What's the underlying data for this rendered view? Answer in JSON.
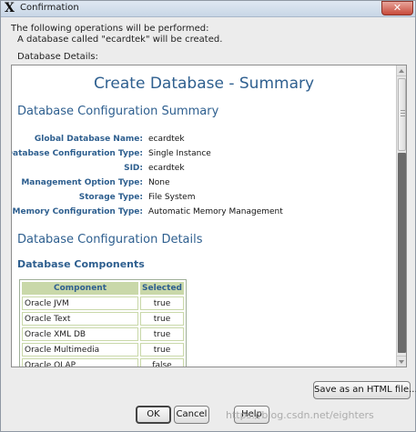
{
  "window": {
    "title": "Confirmation",
    "close_label": "✕"
  },
  "intro": {
    "line1": "The following operations will be performed:",
    "line2": "A database called \"ecardtek\" will be created.",
    "details_label": "Database Details:"
  },
  "summary": {
    "page_title": "Create Database - Summary",
    "config_summary_heading": "Database Configuration Summary",
    "fields": [
      {
        "label": "Global Database Name:",
        "value": "ecardtek"
      },
      {
        "label": "Database Configuration Type:",
        "value": "Single Instance"
      },
      {
        "label": "SID:",
        "value": "ecardtek"
      },
      {
        "label": "Management Option Type:",
        "value": "None"
      },
      {
        "label": "Storage Type:",
        "value": "File System"
      },
      {
        "label": "Memory Configuration Type:",
        "value": "Automatic Memory Management"
      }
    ],
    "config_details_heading": "Database Configuration Details",
    "components_heading": "Database Components",
    "components_table": {
      "headers": [
        "Component",
        "Selected"
      ],
      "rows": [
        [
          "Oracle JVM",
          "true"
        ],
        [
          "Oracle Text",
          "true"
        ],
        [
          "Oracle XML DB",
          "true"
        ],
        [
          "Oracle Multimedia",
          "true"
        ],
        [
          "Oracle OLAP",
          "false"
        ]
      ]
    }
  },
  "buttons": {
    "save_html": "Save as an HTML file...",
    "ok": "OK",
    "cancel": "Cancel",
    "help": "Help"
  },
  "watermark": "https://blog.csdn.net/eighters",
  "colors": {
    "heading_blue": "#2e5f8f",
    "table_header_green": "#c9d8a9",
    "close_button_red": "#c7493a"
  }
}
